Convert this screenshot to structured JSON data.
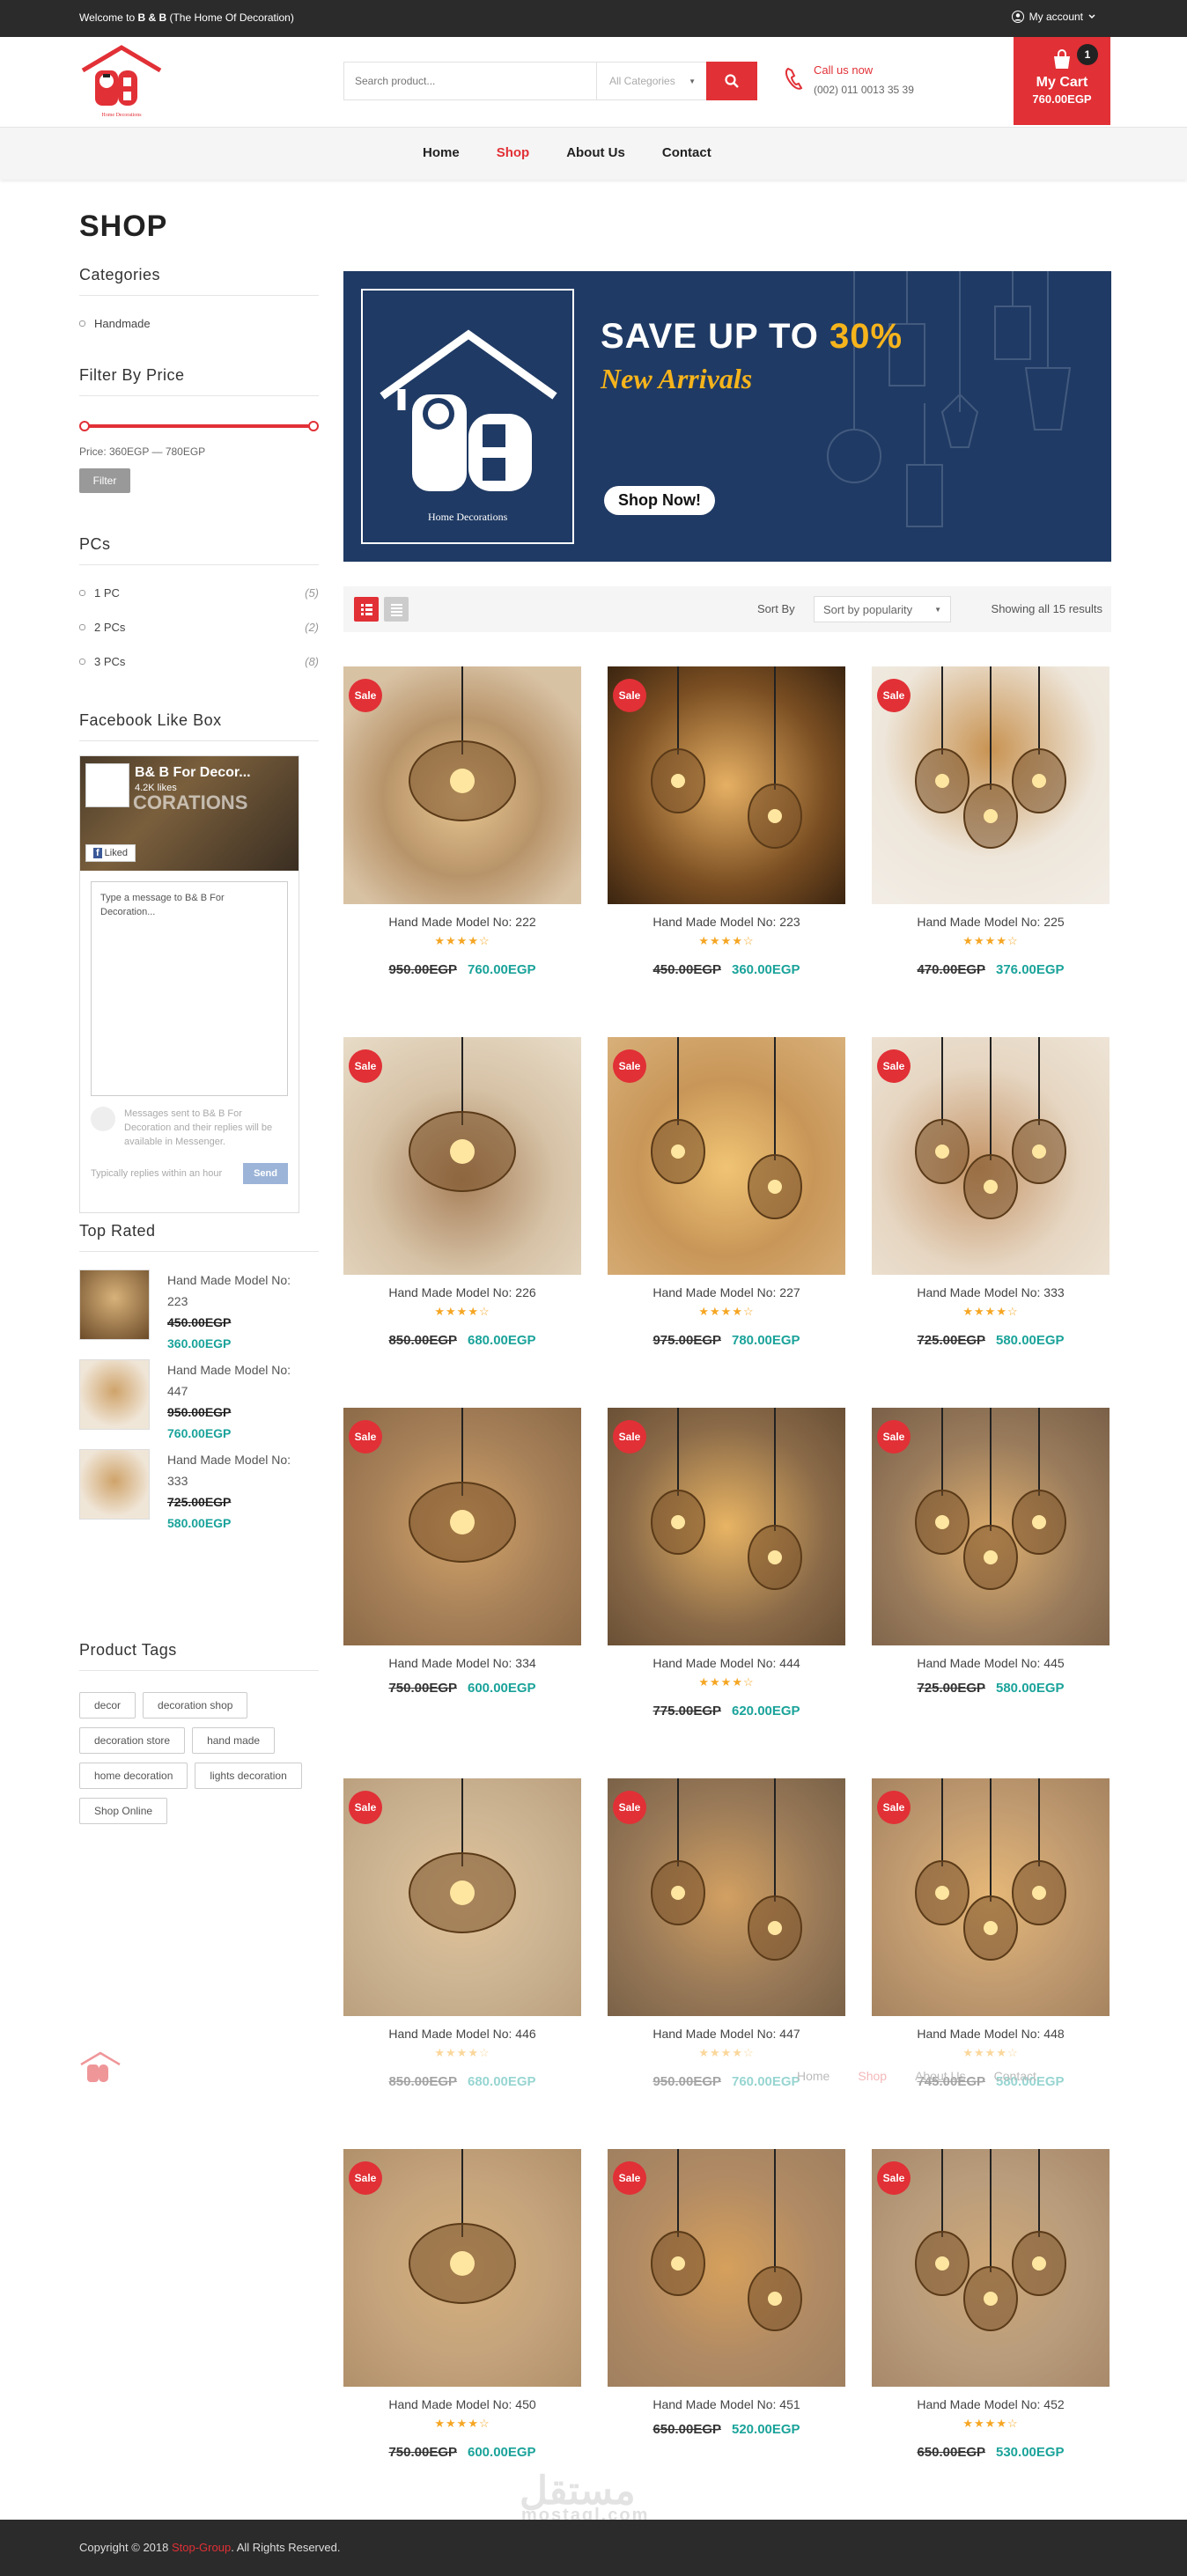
{
  "topbar": {
    "welcome_pre": "Welcome to ",
    "brand": "B & B",
    "welcome_post": " (The Home Of Decoration)",
    "account": "My account"
  },
  "header": {
    "search_placeholder": "Search product...",
    "category": "All Categories",
    "call_label": "Call us now",
    "call_number": "(002) 011 0013 35 39",
    "cart_label": "My Cart",
    "cart_amount": "760.00EGP",
    "cart_count": "1",
    "logo_caption": "Home Decorations"
  },
  "nav": [
    "Home",
    "Shop",
    "About Us",
    "Contact"
  ],
  "page_title": "SHOP",
  "sidebar": {
    "categories_title": "Categories",
    "categories": [
      "Handmade"
    ],
    "filter_title": "Filter By Price",
    "price_range": "Price:  360EGP — 780EGP",
    "filter_button": "Filter",
    "pcs_title": "PCs",
    "pcs": [
      {
        "label": "1 PC",
        "count": "(5)"
      },
      {
        "label": "2 PCs",
        "count": "(2)"
      },
      {
        "label": "3 PCs",
        "count": "(8)"
      }
    ],
    "facebook_title": "Facebook Like Box",
    "facebook": {
      "page_name": "B& B For Decor...",
      "likes": "4.2K likes",
      "cover_text": "CORATIONS",
      "liked": "Liked",
      "message_placeholder": "Type a message to B& B For Decoration...",
      "note": "Messages sent to B& B For Decoration and their replies will be available in Messenger.",
      "reply_time": "Typically replies within an hour",
      "send": "Send"
    },
    "top_rated_title": "Top Rated",
    "top_rated": [
      {
        "name": "Hand Made Model No: 223",
        "old": "450.00EGP",
        "new": "360.00EGP"
      },
      {
        "name": "Hand Made Model No: 447",
        "old": "950.00EGP",
        "new": "760.00EGP"
      },
      {
        "name": "Hand Made Model No: 333",
        "old": "725.00EGP",
        "new": "580.00EGP"
      }
    ],
    "tags_title": "Product Tags",
    "tags": [
      "decor",
      "decoration shop",
      "decoration store",
      "hand made",
      "home decoration",
      "lights decoration",
      "Shop Online"
    ]
  },
  "banner": {
    "headline_pre": "SAVE UP TO ",
    "headline_pct": "30%",
    "subline": "New Arrivals",
    "button": "Shop Now!",
    "logo_caption": "Home Decorations"
  },
  "toolbar": {
    "sort_by": "Sort By",
    "sort_value": "Sort by popularity",
    "results": "Showing all 15 results"
  },
  "sale_badge": "Sale",
  "products": [
    {
      "name": "Hand Made Model No: 222",
      "old": "950.00EGP",
      "new": "760.00EGP",
      "rating": 4
    },
    {
      "name": "Hand Made Model No: 223",
      "old": "450.00EGP",
      "new": "360.00EGP",
      "rating": 4
    },
    {
      "name": "Hand Made Model No: 225",
      "old": "470.00EGP",
      "new": "376.00EGP",
      "rating": 4
    },
    {
      "name": "Hand Made Model No: 226",
      "old": "850.00EGP",
      "new": "680.00EGP",
      "rating": 4
    },
    {
      "name": "Hand Made Model No: 227",
      "old": "975.00EGP",
      "new": "780.00EGP",
      "rating": 4
    },
    {
      "name": "Hand Made Model No: 333",
      "old": "725.00EGP",
      "new": "580.00EGP",
      "rating": 4
    },
    {
      "name": "Hand Made Model No: 334",
      "old": "750.00EGP",
      "new": "600.00EGP",
      "rating": 0
    },
    {
      "name": "Hand Made Model No: 444",
      "old": "775.00EGP",
      "new": "620.00EGP",
      "rating": 4
    },
    {
      "name": "Hand Made Model No: 445",
      "old": "725.00EGP",
      "new": "580.00EGP",
      "rating": 0
    },
    {
      "name": "Hand Made Model No: 446",
      "old": "850.00EGP",
      "new": "680.00EGP",
      "rating": 4
    },
    {
      "name": "Hand Made Model No: 447",
      "old": "950.00EGP",
      "new": "760.00EGP",
      "rating": 4
    },
    {
      "name": "Hand Made Model No: 448",
      "old": "745.00EGP",
      "new": "580.00EGP",
      "rating": 4
    },
    {
      "name": "Hand Made Model No: 450",
      "old": "750.00EGP",
      "new": "600.00EGP",
      "rating": 4
    },
    {
      "name": "Hand Made Model No: 451",
      "old": "650.00EGP",
      "new": "520.00EGP",
      "rating": 0
    },
    {
      "name": "Hand Made Model No: 452",
      "old": "650.00EGP",
      "new": "530.00EGP",
      "rating": 4
    }
  ],
  "sticky_nav": [
    "Home",
    "Shop",
    "About Us",
    "Contact"
  ],
  "watermark": {
    "arabic": "مستقل",
    "latin": "mostaql.com"
  },
  "footer": {
    "pre": "Copyright © 2018 ",
    "link": "Stop-Group",
    "post": ". All Rights Reserved."
  },
  "colors": {
    "accent": "#e13036",
    "price": "#1aa39a",
    "dark": "#2b2b2b",
    "banner": "#1f3a64",
    "gold": "#f6b41c"
  }
}
